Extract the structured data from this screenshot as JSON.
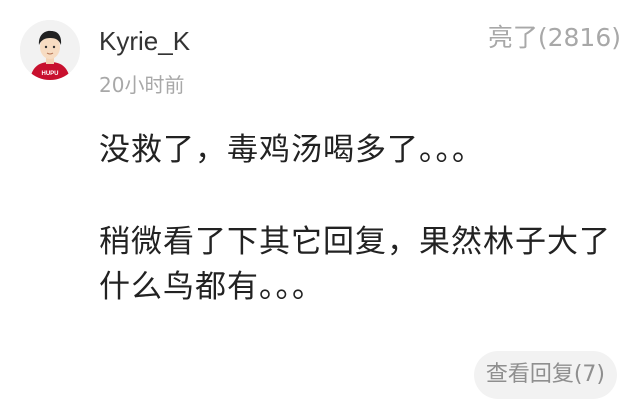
{
  "comment": {
    "avatar_icon": "user-avatar-hupu-jersey-icon",
    "avatar_badge_text": "HUPU",
    "username": "Kyrie_K",
    "timestamp": "20小时前",
    "likes_label": "亮了(2816)",
    "body_paragraph_1": "没救了，毒鸡汤喝多了。。。",
    "body_paragraph_2": "稍微看了下其它回复，果然林子大了什么鸟都有。。。",
    "view_replies_label": "查看回复(7)"
  },
  "colors": {
    "background": "#ffffff",
    "username": "#333333",
    "muted_text": "#a8a8a8",
    "body_text": "#222222",
    "jersey_red": "#c8102e",
    "button_bg": "#f2f2f2"
  }
}
